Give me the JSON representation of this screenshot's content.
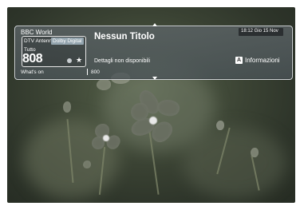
{
  "channel": {
    "name": "BBC World",
    "source": "DTV Antenna",
    "audio_badge": "Dolby Digital",
    "group": "Tutto",
    "number": "808"
  },
  "program": {
    "title": "Nessun Titolo",
    "details": "Dettagli non disponibili",
    "number": "800"
  },
  "clock": {
    "datetime": "18:12 Gio 15 Nov"
  },
  "footer": {
    "whats_on": "What's on"
  },
  "info_button": {
    "key": "A",
    "label": "Informazioni"
  },
  "icons": {
    "up": "up-arrow-icon",
    "down": "down-arrow-icon",
    "star": "star-icon",
    "dot": "circle-icon"
  }
}
